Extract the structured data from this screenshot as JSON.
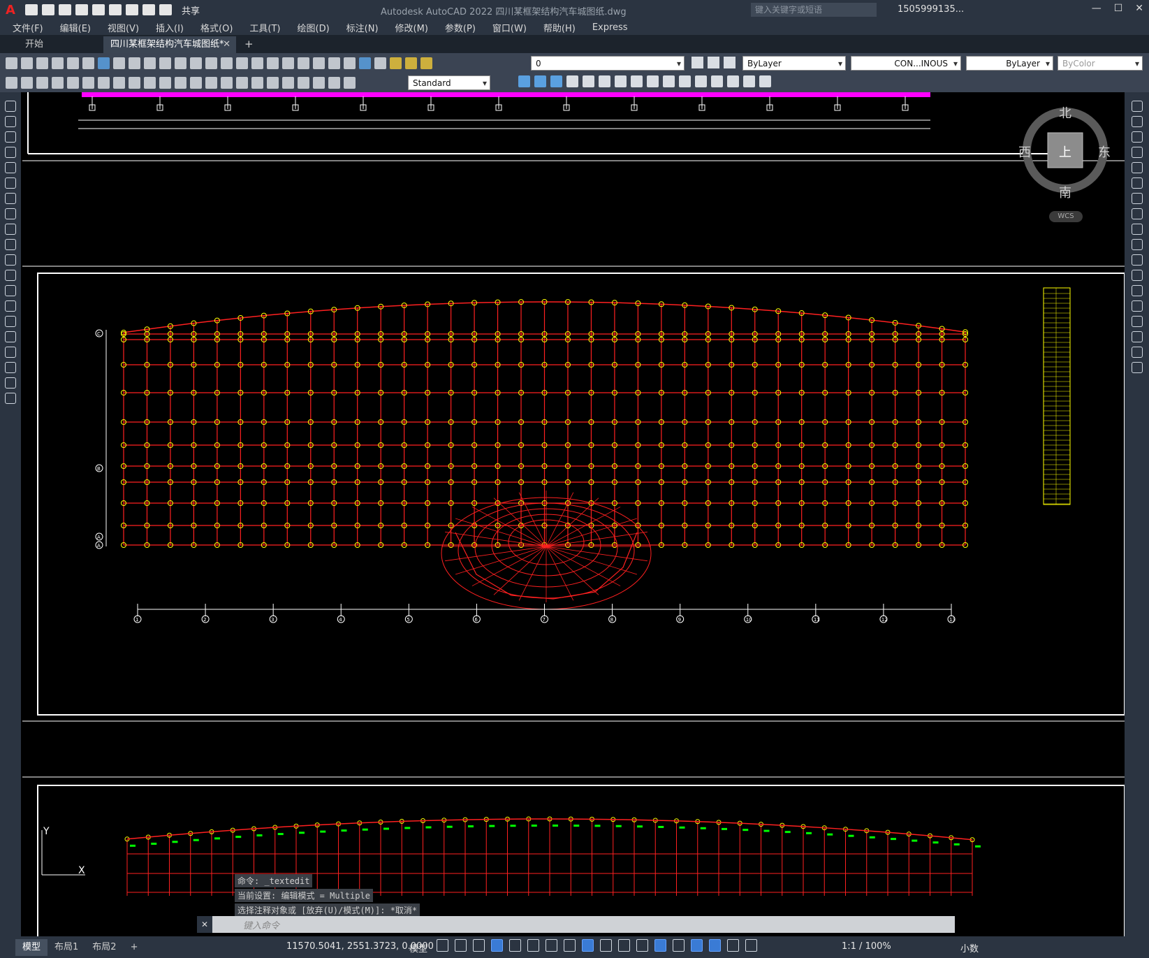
{
  "app": {
    "title": "Autodesk AutoCAD 2022    四川某框架结构汽车城图纸.dwg",
    "logo": "A",
    "share_label": "共享",
    "search_placeholder": "键入关键字或短语",
    "user": "1505999135..."
  },
  "menu": [
    "文件(F)",
    "编辑(E)",
    "视图(V)",
    "插入(I)",
    "格式(O)",
    "工具(T)",
    "绘图(D)",
    "标注(N)",
    "修改(M)",
    "参数(P)",
    "窗口(W)",
    "帮助(H)",
    "Express"
  ],
  "tabs": {
    "home": "开始",
    "active": "四川某框架结构汽车城图纸*",
    "close": "✕",
    "add": "+"
  },
  "properties": {
    "layer": "0",
    "color": "ByLayer",
    "linetype": "CON...INOUS",
    "lineweight": "ByLayer",
    "plotstyle": "ByColor",
    "textstyle": "Standard"
  },
  "viewcube": {
    "north": "北",
    "south": "南",
    "east": "东",
    "west": "西",
    "top": "上",
    "wcs": "WCS"
  },
  "drawing": {
    "grid_labels_left": [
      "C",
      "B",
      "A",
      "A"
    ],
    "grid_labels_bottom": [
      "1",
      "2",
      "3",
      "4",
      "5",
      "6",
      "7",
      "8",
      "9",
      "10",
      "11",
      "12",
      "13"
    ],
    "ucs_y": "Y",
    "ucs_x": "X",
    "colors": {
      "member": "#ff2020",
      "top_frame": "#ff00ff",
      "dim": "#ffffff",
      "legend": "#ffff00",
      "tag": "#00ff00"
    }
  },
  "command": {
    "history": [
      "命令: _textedit",
      "当前设置: 编辑模式 = Multiple",
      "选择注释对象或 [放弃(U)/模式(M)]: *取消*"
    ],
    "placeholder": "键入命令"
  },
  "status": {
    "layouts": [
      "模型",
      "布局1",
      "布局2"
    ],
    "add_layout": "+",
    "coords": "11570.5041, 2551.3723, 0.0000",
    "space": "模型",
    "scale": "1:1 / 100%",
    "units": "小数"
  }
}
